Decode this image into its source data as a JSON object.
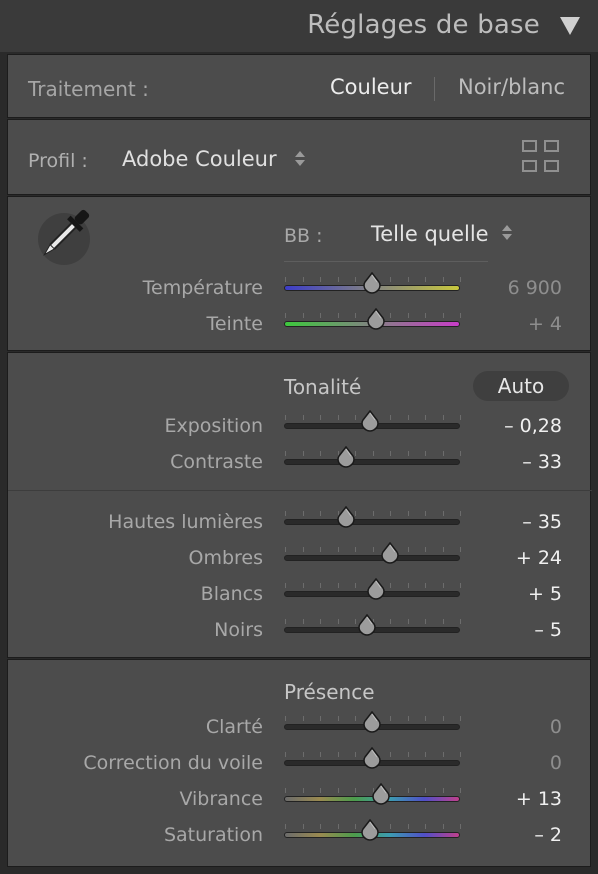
{
  "header": {
    "title": "Réglages de base",
    "collapse_icon": "triangle-down-icon"
  },
  "treatment": {
    "label": "Traitement :",
    "color_option": "Couleur",
    "bw_option": "Noir/blanc",
    "selected": "Couleur"
  },
  "profile": {
    "label": "Profil :",
    "value": "Adobe Couleur",
    "browser_icon": "grid-icon"
  },
  "white_balance": {
    "eyedropper_icon": "eyedropper-icon",
    "label": "BB :",
    "value": "Telle quelle",
    "sliders": [
      {
        "label": "Température",
        "value": "6 900",
        "position": 0.5
      },
      {
        "label": "Teinte",
        "value": "+ 4",
        "position": 0.52
      }
    ]
  },
  "tone": {
    "title": "Tonalité",
    "auto_label": "Auto",
    "sliders": [
      {
        "label": "Exposition",
        "value": "– 0,28",
        "position": 0.49
      },
      {
        "label": "Contraste",
        "value": "– 33",
        "position": 0.35
      },
      {
        "label": "Hautes lumières",
        "value": "– 35",
        "position": 0.35
      },
      {
        "label": "Ombres",
        "value": "+ 24",
        "position": 0.6
      },
      {
        "label": "Blancs",
        "value": "+ 5",
        "position": 0.52
      },
      {
        "label": "Noirs",
        "value": "– 5",
        "position": 0.47
      }
    ]
  },
  "presence": {
    "title": "Présence",
    "sliders": [
      {
        "label": "Clarté",
        "value": "0",
        "position": 0.5
      },
      {
        "label": "Correction du voile",
        "value": "0",
        "position": 0.5
      },
      {
        "label": "Vibrance",
        "value": "+ 13",
        "position": 0.55
      },
      {
        "label": "Saturation",
        "value": "– 2",
        "position": 0.49
      }
    ]
  },
  "colors": {
    "panel_bg": "#4c4c4c",
    "temp_gradient": [
      "#3d3dc8",
      "#c8c83d"
    ],
    "tint_gradient": [
      "#3dc83d",
      "#c83dc8"
    ],
    "spectrum_gradient": [
      "#9a5050",
      "#b08c3c",
      "#4c9c4c",
      "#3c9cb0",
      "#5050c8",
      "#c0408c"
    ]
  }
}
